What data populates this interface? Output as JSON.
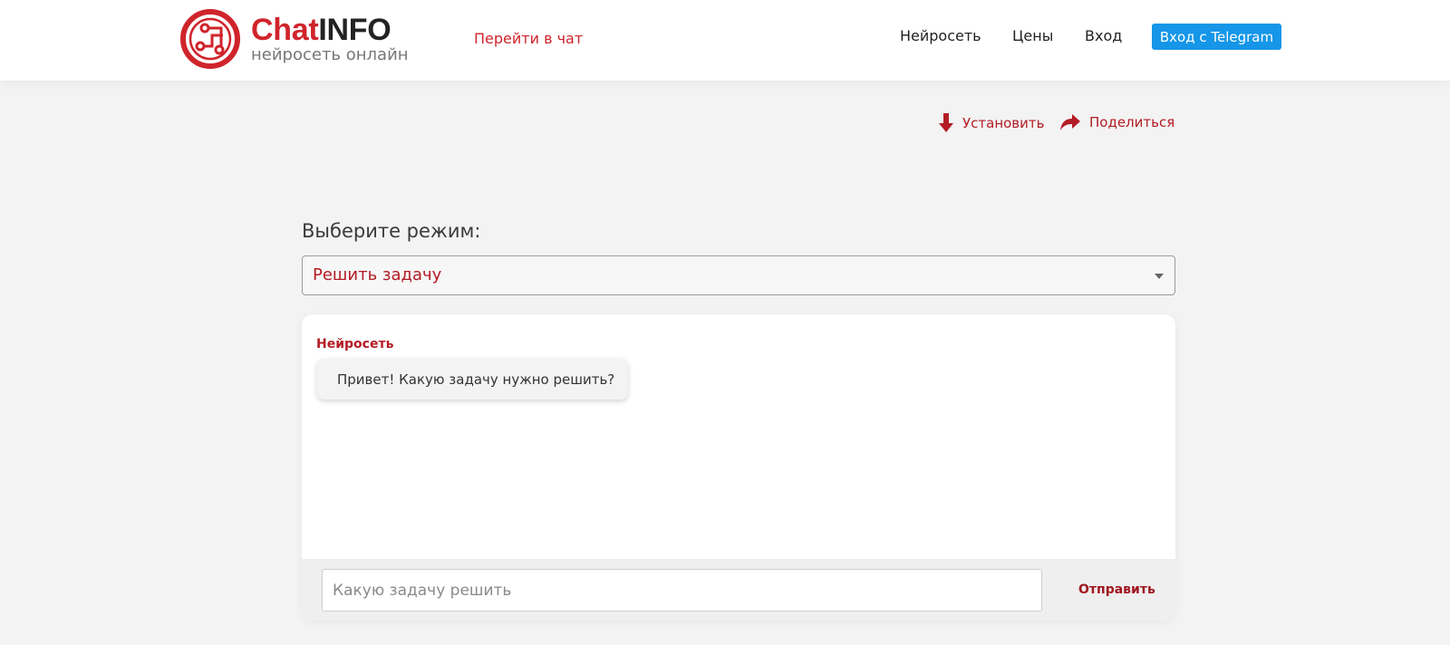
{
  "header": {
    "brand_chat": "Chat",
    "brand_info": "INFO",
    "tagline": "нейросеть онлайн",
    "goto_chat": "Перейти в чат",
    "nav": {
      "neuro": "Нейросеть",
      "prices": "Цены",
      "login": "Вход",
      "telegram": "Вход с Telegram"
    }
  },
  "actions": {
    "install": "Установить",
    "share": "Поделиться"
  },
  "mode": {
    "label": "Выберите режим:",
    "selected": "Решить задачу"
  },
  "chat": {
    "sender": "Нейросеть",
    "message": "Привет! Какую задачу нужно решить?",
    "input_placeholder": "Какую задачу решить",
    "send_label": "Отправить"
  },
  "colors": {
    "brand_red": "#d0242b",
    "accent_red": "#b31c24",
    "telegram_blue": "#1596e8",
    "page_bg": "#f3f3f3"
  },
  "icons": {
    "logo": "chatinfo-logo-icon",
    "install": "arrow-down-icon",
    "share": "share-arrow-icon",
    "select": "caret-down-icon"
  }
}
